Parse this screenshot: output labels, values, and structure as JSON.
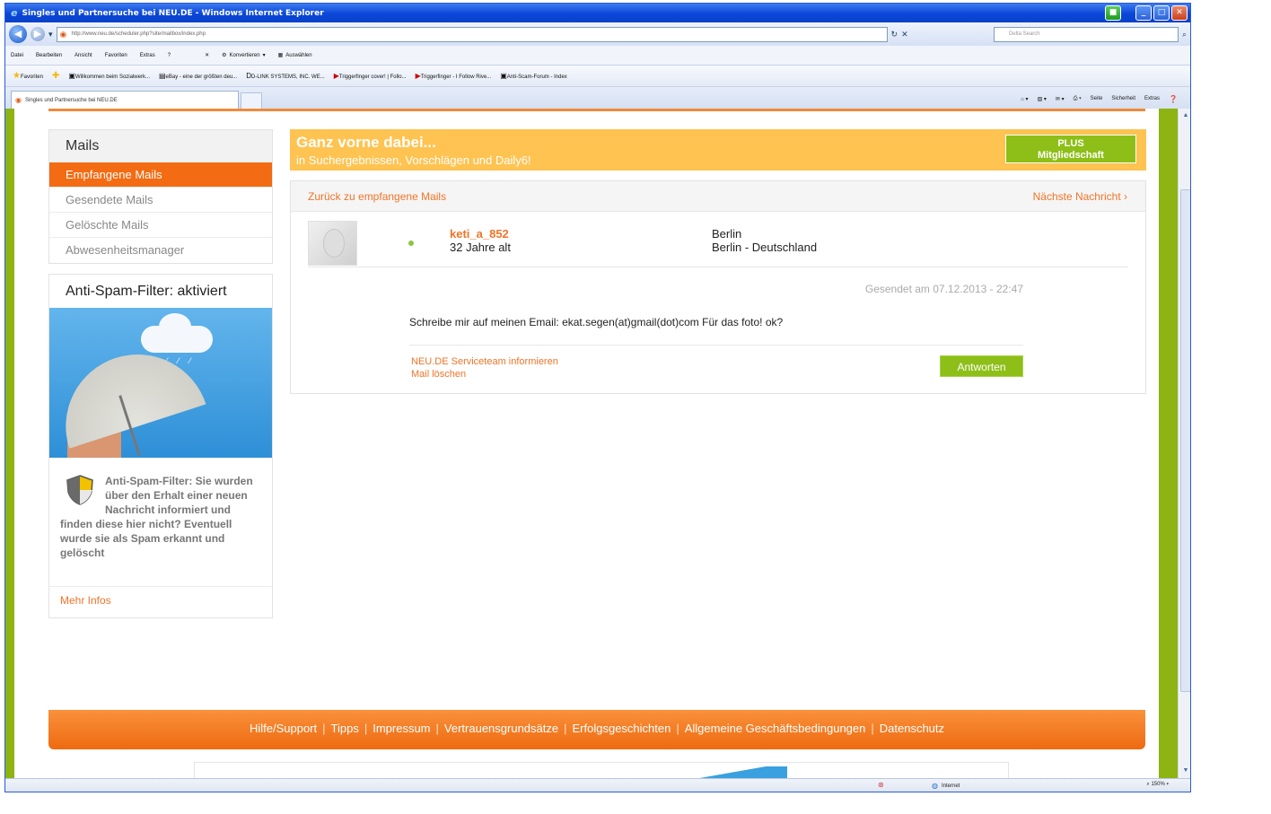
{
  "browser": {
    "title": "Singles und Partnersuche bei NEU.DE - Windows Internet Explorer",
    "url": "http://www.neu.de/scheduler.php?site/mailbox/index.php",
    "search_placeholder": "Delta Search",
    "menu": [
      "Datei",
      "Bearbeiten",
      "Ansicht",
      "Favoriten",
      "Extras",
      "?"
    ],
    "toolbar": [
      "Konvertieren",
      "Auswählen"
    ],
    "favorites_label": "Favoriten",
    "favorites": [
      "Willkommen beim Sozialwerk...",
      "eBay - eine der größten deu...",
      "D-LINK SYSTEMS, INC. WE...",
      "Triggerfinger cover! | Follo...",
      "Triggerfinger - I Follow Rive...",
      "Anti-Scam-Forum - Index"
    ],
    "tab_title": "Singles und Partnersuche bei NEU.DE",
    "commands": [
      "Seite",
      "Sicherheit",
      "Extras"
    ],
    "status_zone": "Internet",
    "zoom": "150%"
  },
  "sidebar": {
    "mails_title": "Mails",
    "items": [
      {
        "label": "Empfangene Mails",
        "active": true
      },
      {
        "label": "Gesendete Mails",
        "active": false
      },
      {
        "label": "Gelöschte Mails",
        "active": false
      },
      {
        "label": "Abwesenheitsmanager",
        "active": false
      }
    ],
    "spam_title": "Anti-Spam-Filter: aktiviert",
    "spam_text": "Anti-Spam-Filter: Sie wurden über den Erhalt einer neuen Nachricht informiert und finden diese hier nicht? Eventuell wurde sie als Spam erkannt und gelöscht",
    "more_info": "Mehr Infos"
  },
  "promo": {
    "title": "Ganz vorne dabei...",
    "subtitle": "in Suchergebnissen, Vorschlägen und Daily6!",
    "button_line1": "PLUS",
    "button_line2": "Mitgliedschaft"
  },
  "message": {
    "back_link": "Zurück zu empfangene Mails",
    "next_link": "Nächste Nachricht",
    "sender_name": "keti_a_852",
    "sender_age": "32 Jahre alt",
    "city": "Berlin",
    "region": "Berlin - Deutschland",
    "sent_at": "Gesendet am 07.12.2013 - 22:47",
    "body": "Schreibe mir auf meinen Email: ekat.segen(at)gmail(dot)com Für das foto! ok?",
    "report_link": "NEU.DE Serviceteam informieren",
    "delete_link": "Mail löschen",
    "reply_button": "Antworten"
  },
  "footer": {
    "links": [
      "Hilfe/Support",
      "Tipps",
      "Impressum",
      "Vertrauensgrundsätze",
      "Erfolgsgeschichten",
      "Allgemeine Geschäftsbedingungen",
      "Datenschutz"
    ]
  },
  "colors": {
    "accent_orange": "#f36b12",
    "promo_yellow": "#ffc351",
    "button_green": "#8dbf18",
    "frame_green": "#8db412"
  }
}
